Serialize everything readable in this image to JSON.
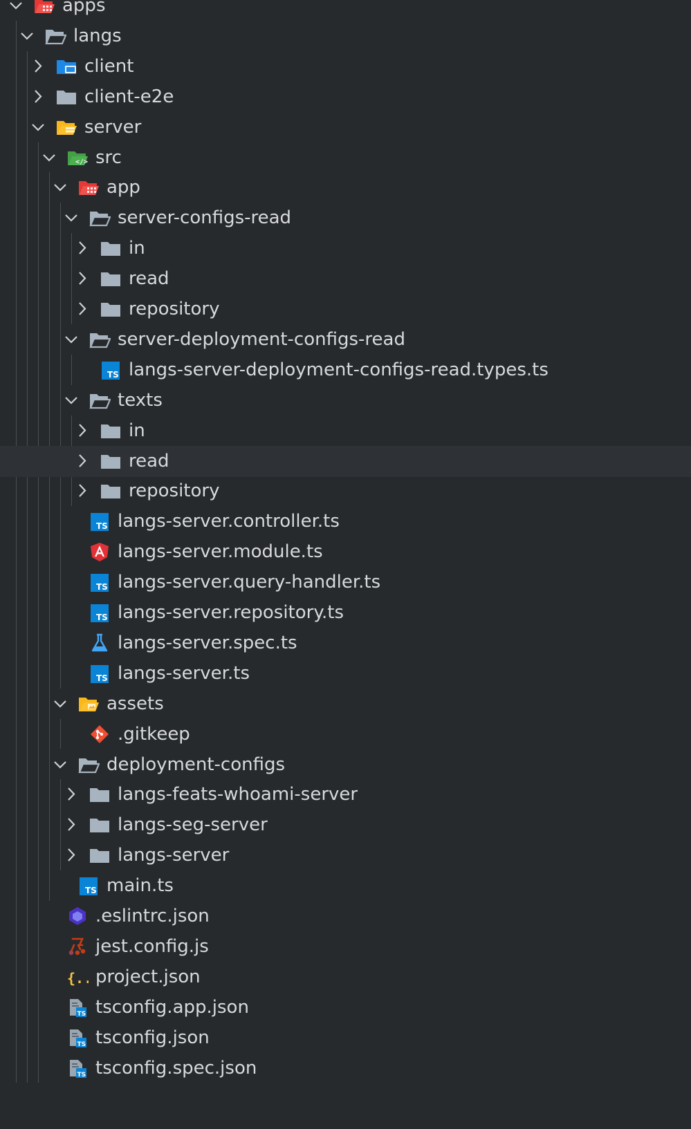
{
  "explorer": {
    "selected_row_index": 15,
    "colors": {
      "background": "#272a2d",
      "row_hover": "#2e3236",
      "text": "#d7d9dd",
      "folder_gray": "#a7b4bf",
      "typescript_blue": "#0a84d6",
      "angular_red": "#e23237",
      "git_orange": "#f14e32",
      "json_yellow": "#f5c542"
    },
    "rows": [
      {
        "label": "apps",
        "level": 0,
        "chevron": "open",
        "icon": "folder-apps-icon"
      },
      {
        "label": "langs",
        "level": 1,
        "chevron": "open",
        "icon": "folder-open-icon"
      },
      {
        "label": "client",
        "level": 2,
        "chevron": "closed",
        "icon": "folder-client-icon"
      },
      {
        "label": "client-e2e",
        "level": 2,
        "chevron": "closed",
        "icon": "folder-icon"
      },
      {
        "label": "server",
        "level": 2,
        "chevron": "open",
        "icon": "folder-server-icon"
      },
      {
        "label": "src",
        "level": 3,
        "chevron": "open",
        "icon": "folder-src-icon"
      },
      {
        "label": "app",
        "level": 4,
        "chevron": "open",
        "icon": "folder-app-icon"
      },
      {
        "label": "server-configs-read",
        "level": 5,
        "chevron": "open",
        "icon": "folder-open-icon"
      },
      {
        "label": "in",
        "level": 6,
        "chevron": "closed",
        "icon": "folder-icon"
      },
      {
        "label": "read",
        "level": 6,
        "chevron": "closed",
        "icon": "folder-icon"
      },
      {
        "label": "repository",
        "level": 6,
        "chevron": "closed",
        "icon": "folder-icon"
      },
      {
        "label": "server-deployment-configs-read",
        "level": 5,
        "chevron": "open",
        "icon": "folder-open-icon"
      },
      {
        "label": "langs-server-deployment-configs-read.types.ts",
        "level": 6,
        "chevron": "none",
        "icon": "typescript-icon"
      },
      {
        "label": "texts",
        "level": 5,
        "chevron": "open",
        "icon": "folder-open-icon"
      },
      {
        "label": "in",
        "level": 6,
        "chevron": "closed",
        "icon": "folder-icon"
      },
      {
        "label": "read",
        "level": 6,
        "chevron": "closed",
        "icon": "folder-icon"
      },
      {
        "label": "repository",
        "level": 6,
        "chevron": "closed",
        "icon": "folder-icon"
      },
      {
        "label": "langs-server.controller.ts",
        "level": 5,
        "chevron": "none",
        "icon": "typescript-icon"
      },
      {
        "label": "langs-server.module.ts",
        "level": 5,
        "chevron": "none",
        "icon": "angular-icon"
      },
      {
        "label": "langs-server.query-handler.ts",
        "level": 5,
        "chevron": "none",
        "icon": "typescript-icon"
      },
      {
        "label": "langs-server.repository.ts",
        "level": 5,
        "chevron": "none",
        "icon": "typescript-icon"
      },
      {
        "label": "langs-server.spec.ts",
        "level": 5,
        "chevron": "none",
        "icon": "test-flask-icon"
      },
      {
        "label": "langs-server.ts",
        "level": 5,
        "chevron": "none",
        "icon": "typescript-icon"
      },
      {
        "label": "assets",
        "level": 4,
        "chevron": "open",
        "icon": "folder-assets-icon"
      },
      {
        "label": ".gitkeep",
        "level": 5,
        "chevron": "none",
        "icon": "git-icon"
      },
      {
        "label": "deployment-configs",
        "level": 4,
        "chevron": "open",
        "icon": "folder-open-icon"
      },
      {
        "label": "langs-feats-whoami-server",
        "level": 5,
        "chevron": "closed",
        "icon": "folder-icon"
      },
      {
        "label": "langs-seg-server",
        "level": 5,
        "chevron": "closed",
        "icon": "folder-icon"
      },
      {
        "label": "langs-server",
        "level": 5,
        "chevron": "closed",
        "icon": "folder-icon"
      },
      {
        "label": "main.ts",
        "level": 4,
        "chevron": "none",
        "icon": "typescript-icon"
      },
      {
        "label": ".eslintrc.json",
        "level": 3,
        "chevron": "none",
        "icon": "eslint-icon"
      },
      {
        "label": "jest.config.js",
        "level": 3,
        "chevron": "none",
        "icon": "jest-icon"
      },
      {
        "label": "project.json",
        "level": 3,
        "chevron": "none",
        "icon": "json-icon"
      },
      {
        "label": "tsconfig.app.json",
        "level": 3,
        "chevron": "none",
        "icon": "tsconfig-icon"
      },
      {
        "label": "tsconfig.json",
        "level": 3,
        "chevron": "none",
        "icon": "tsconfig-icon"
      },
      {
        "label": "tsconfig.spec.json",
        "level": 3,
        "chevron": "none",
        "icon": "tsconfig-icon"
      }
    ]
  }
}
